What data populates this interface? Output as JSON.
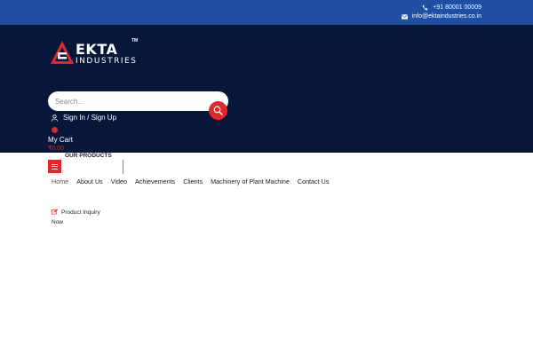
{
  "topbar": {
    "phone": "+91 80001 00009",
    "email": "info@ektaindustries.co.in",
    "phone_icon": "phone-icon",
    "email_icon": "envelope-icon"
  },
  "brand": {
    "name": "EKTA",
    "subtitle": "INDUSTRIES",
    "trademark": "TM"
  },
  "search": {
    "placeholder": "Search...",
    "button_icon": "search-icon"
  },
  "account": {
    "label": "Sign In / Sign Up",
    "icon": "user-icon"
  },
  "cart": {
    "label": "My Cart",
    "amount": "₹0.00"
  },
  "products_menu": {
    "label": "OUR PRODUCTS",
    "icon": "hamburger-icon"
  },
  "nav": {
    "items": [
      {
        "label": "Home"
      },
      {
        "label": "About Us"
      },
      {
        "label": "Video"
      },
      {
        "label": "Achievements"
      },
      {
        "label": "Clients"
      },
      {
        "label": "Machinery of Plant Machine"
      },
      {
        "label": "Contact Us"
      }
    ]
  },
  "inquiry": {
    "label": "Product Inquiry Now",
    "icon": "edit-icon"
  },
  "colors": {
    "topbar": "#1e4fa3",
    "header": "#07173a",
    "accent": "#e2262a"
  }
}
